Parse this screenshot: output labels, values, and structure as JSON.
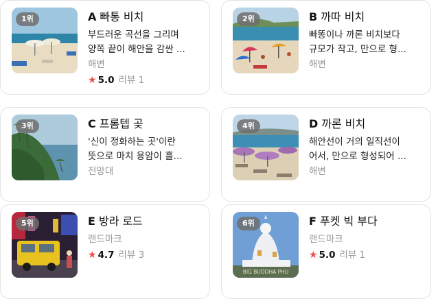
{
  "cards": [
    {
      "rank": "1위",
      "letter": "A",
      "name": "빠통 비치",
      "desc1": "부드러운 곡선을 그리며",
      "desc2": "양쪽 끝이 해안을 감싼 ...",
      "category": "해변",
      "score": "5.0",
      "reviews": "리뷰 1"
    },
    {
      "rank": "2위",
      "letter": "B",
      "name": "까따 비치",
      "desc1": "빠똥이나 까론 비치보다",
      "desc2": "규모가 작고, 만으로 형...",
      "category": "해변"
    },
    {
      "rank": "3위",
      "letter": "C",
      "name": "프롬텝 곶",
      "desc1": "'신이 정화하는 곳'이란",
      "desc2": "뜻으로 마치 용암이 흘...",
      "category": "전망대"
    },
    {
      "rank": "4위",
      "letter": "D",
      "name": "까론 비치",
      "desc1": "해안선이 거의 일직선이",
      "desc2": "어서, 만으로 형성되어 ...",
      "category": "해변"
    },
    {
      "rank": "5위",
      "letter": "E",
      "name": "방라 로드",
      "category": "랜드마크",
      "score": "4.7",
      "reviews": "리뷰 3"
    },
    {
      "rank": "6위",
      "letter": "F",
      "name": "푸켓 빅 부다",
      "category": "랜드마크",
      "score": "5.0",
      "reviews": "리뷰 1",
      "photo_sign": "BIG BUDDHA PHU"
    }
  ],
  "colors": {
    "star": "#ef4b4b",
    "muted": "#999999",
    "border": "#e2e2e2"
  },
  "icons": {
    "rating": "star-icon"
  }
}
